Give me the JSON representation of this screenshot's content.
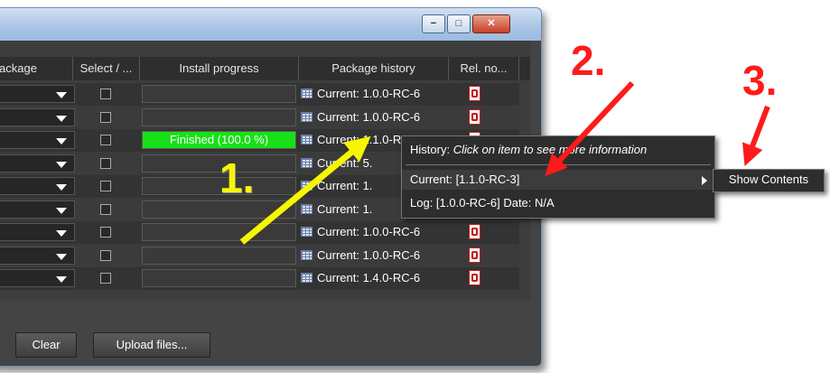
{
  "window": {
    "minimize_glyph": "−",
    "maximize_glyph": "□",
    "close_glyph": "✕"
  },
  "table": {
    "columns": [
      "ackage",
      "Select / ...",
      "Install progress",
      "Package history",
      "Rel. no..."
    ],
    "rows": [
      {
        "progress": "",
        "history": "Current: 1.0.0-RC-6"
      },
      {
        "progress": "",
        "history": "Current: 1.0.0-RC-6"
      },
      {
        "progress": "Finished (100.0 %)",
        "history": "Current: 1.1.0-RC-3"
      },
      {
        "progress": "",
        "history": "Current: 5."
      },
      {
        "progress": "",
        "history": "Current: 1."
      },
      {
        "progress": "",
        "history": "Current: 1."
      },
      {
        "progress": "",
        "history": "Current: 1.0.0-RC-6"
      },
      {
        "progress": "",
        "history": "Current: 1.0.0-RC-6"
      },
      {
        "progress": "",
        "history": "Current: 1.4.0-RC-6"
      }
    ]
  },
  "buttons": {
    "clear": "Clear",
    "upload": "Upload files..."
  },
  "context_menu": {
    "history_label": "History:",
    "history_hint": "Click on item to see more information",
    "current_item": "Current: [1.1.0-RC-3]",
    "log_item": "Log: [1.0.0-RC-6] Date: N/A"
  },
  "submenu": {
    "show_contents": "Show Contents"
  },
  "annotations": {
    "step1": "1.",
    "step2": "2.",
    "step3": "3.",
    "step1_color": "#f6f600",
    "step2_color": "#ff1a1a",
    "step3_color": "#ff1a1a"
  }
}
